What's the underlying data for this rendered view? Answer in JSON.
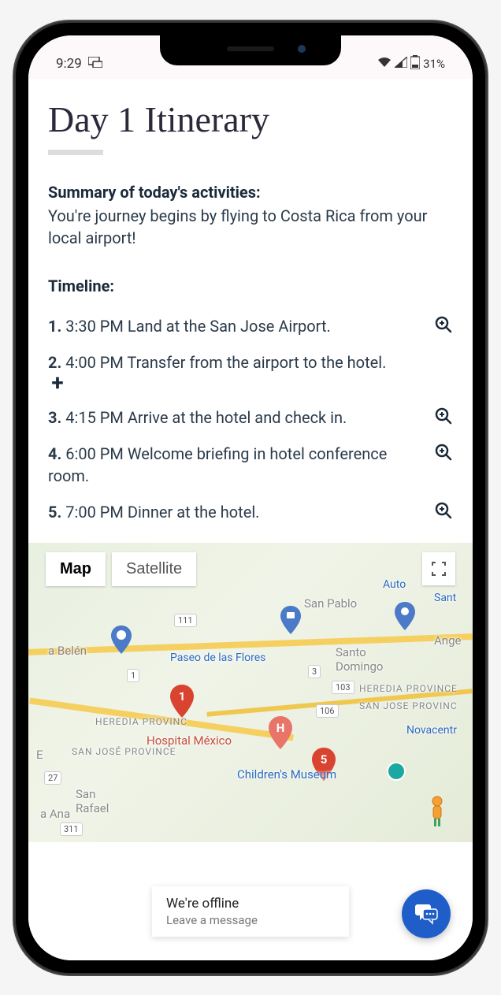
{
  "status_bar": {
    "time": "9:29",
    "battery_pct": "31%"
  },
  "page": {
    "title": "Day 1 Itinerary",
    "summary_label": "Summary of today's activities:",
    "summary_text": "You're journey begins by flying to Costa Rica from your local airport!",
    "timeline_label": "Timeline:"
  },
  "timeline": [
    {
      "num": "1.",
      "text": "3:30 PM Land at the San Jose Airport.",
      "action": "zoom"
    },
    {
      "num": "2.",
      "text": "4:00 PM Transfer from the airport to the hotel.",
      "action": "plus"
    },
    {
      "num": "3.",
      "text": "4:15 PM Arrive at the hotel and check in.",
      "action": "zoom"
    },
    {
      "num": "4.",
      "text": "6:00 PM Welcome briefing in hotel conference room.",
      "action": "zoom"
    },
    {
      "num": "5.",
      "text": "7:00 PM Dinner at the hotel.",
      "action": "zoom"
    }
  ],
  "map": {
    "btn_map": "Map",
    "btn_satellite": "Satellite",
    "pins": [
      {
        "num": "1"
      },
      {
        "num": "5"
      }
    ],
    "labels": {
      "belen": "a Belén",
      "paseo": "Paseo de las Flores",
      "san_pablo": "San Pablo",
      "santo_domingo": "Santo Domingo",
      "auto": "Auto",
      "sant": "Sant",
      "ange": "Ange",
      "heredia1": "HEREDIA PROVINCE",
      "heredia2": "HEREDIA PROVINC",
      "san_jose_prov": "SAN JOSE PROVINC",
      "san_jose_prov2": "SAN JOSÉ PROVINCE",
      "hospital": "Hospital México",
      "childrens": "Children's Museum",
      "novacentr": "Novacentr",
      "san_rafael": "San Rafael",
      "a_ana": "a Ana",
      "e": "E",
      "r111": "111",
      "r1": "1",
      "r3": "3",
      "r27": "27",
      "r103": "103",
      "r106": "106",
      "r311": "311"
    }
  },
  "chat": {
    "offline_title": "We're offline",
    "offline_sub": "Leave a message"
  }
}
